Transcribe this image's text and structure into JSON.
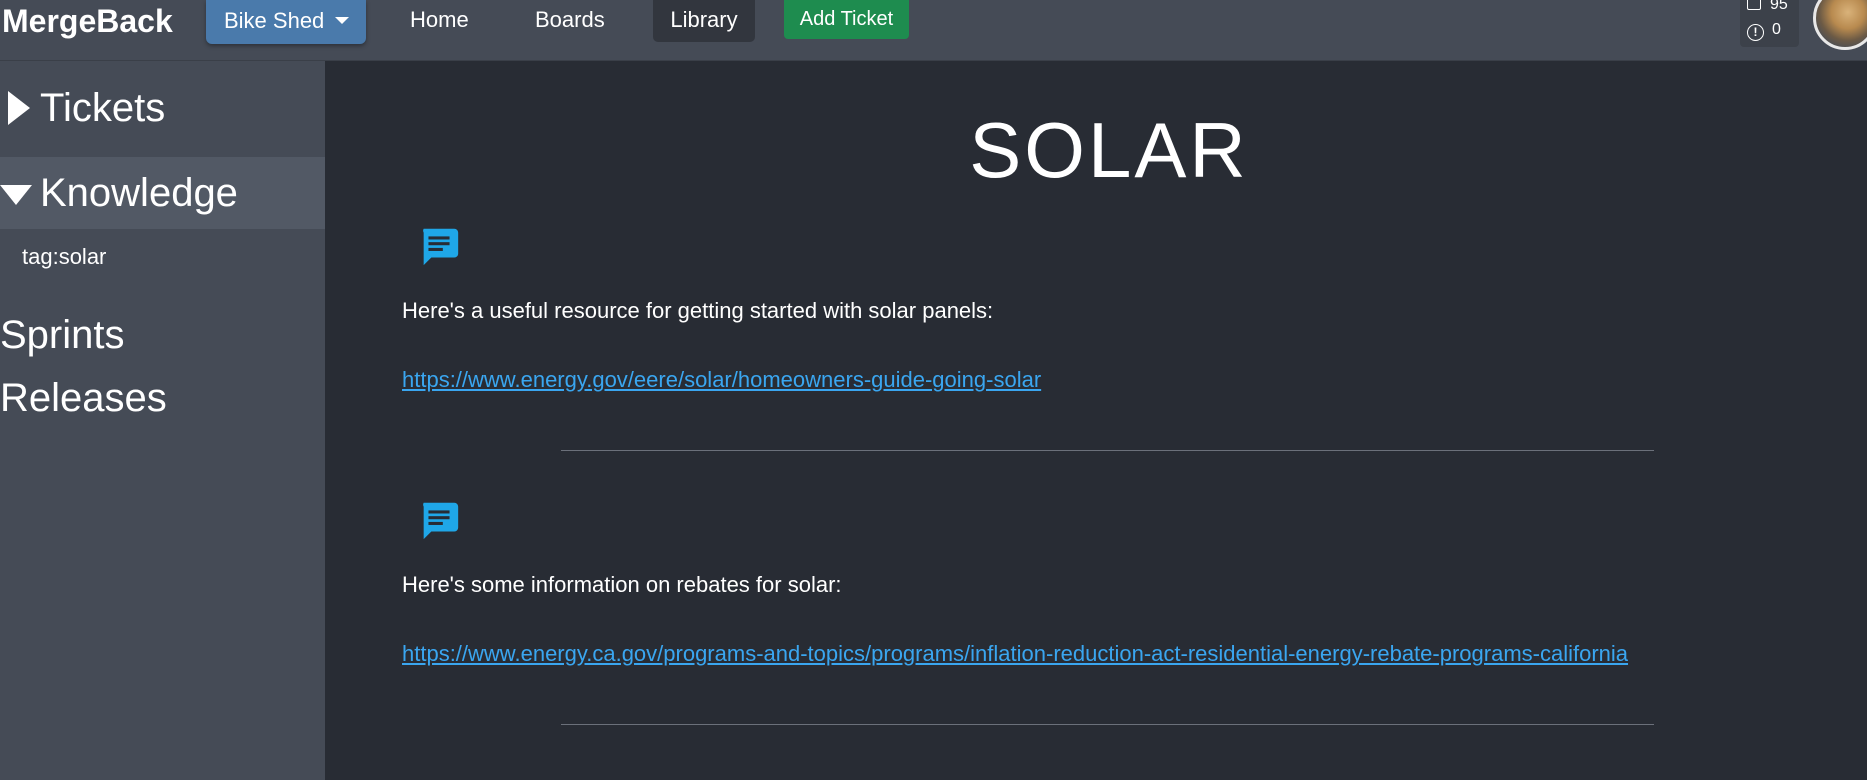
{
  "navbar": {
    "brand": "MergeBack",
    "project": "Bike Shed",
    "links": {
      "home": "Home",
      "boards": "Boards",
      "library": "Library"
    },
    "add_ticket": "Add Ticket",
    "counters": {
      "tickets": "95",
      "alerts": "0"
    },
    "accent_color": "#4a7aab",
    "add_color": "#1e8c4f"
  },
  "sidebar": {
    "tickets": "Tickets",
    "knowledge": "Knowledge",
    "knowledge_tag": "tag:solar",
    "sprints": "Sprints",
    "releases": "Releases"
  },
  "main": {
    "title": "SOLAR",
    "notes": [
      {
        "icon": "chat-icon",
        "text": "Here's a useful resource for getting started with solar panels:",
        "link": "https://www.energy.gov/eere/solar/homeowners-guide-going-solar"
      },
      {
        "icon": "chat-icon",
        "text": "Here's some information on rebates for solar:",
        "link": "https://www.energy.ca.gov/programs-and-topics/programs/inflation-reduction-act-residential-energy-rebate-programs-california"
      }
    ],
    "link_color": "#3aa6f0",
    "icon_color": "#1fa7e8"
  }
}
